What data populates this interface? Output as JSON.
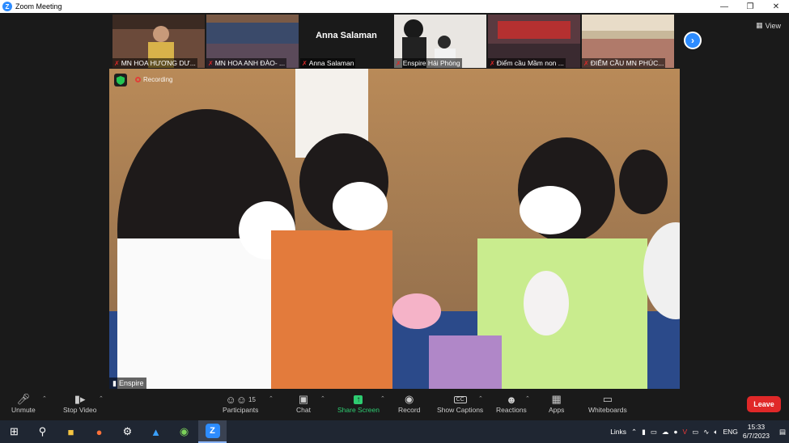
{
  "window": {
    "title": "Zoom Meeting"
  },
  "gallery": {
    "tiles": [
      {
        "name": "MN HOA HƯƠNG DƯ...",
        "kind": "video"
      },
      {
        "name": "MN HOA ANH ĐÀO- ...",
        "kind": "video"
      },
      {
        "name": "Anna Salaman",
        "kind": "name",
        "display_name": "Anna Salaman"
      },
      {
        "name": "Enspire Hải Phòng",
        "kind": "video"
      },
      {
        "name": "Điểm cầu  Mầm non ...",
        "kind": "video"
      },
      {
        "name": "ĐIỂM CẦU MN PHÚC...",
        "kind": "video"
      }
    ],
    "view_label": "View"
  },
  "main_video": {
    "recording_label": "Recording",
    "speaker": "Enspire"
  },
  "toolbar": {
    "unmute": "Unmute",
    "stop_video": "Stop Video",
    "participants": "Participants",
    "participants_count": "15",
    "chat": "Chat",
    "share_screen": "Share Screen",
    "record": "Record",
    "captions": "Show Captions",
    "reactions": "Reactions",
    "apps": "Apps",
    "whiteboards": "Whiteboards",
    "leave": "Leave"
  },
  "taskbar": {
    "links_label": "Links",
    "lang": "ENG",
    "time": "15:33",
    "date": "6/7/2023"
  },
  "colors": {
    "zoom_blue": "#2d8cff",
    "leave_red": "#e02828",
    "share_green": "#2ecc71"
  }
}
